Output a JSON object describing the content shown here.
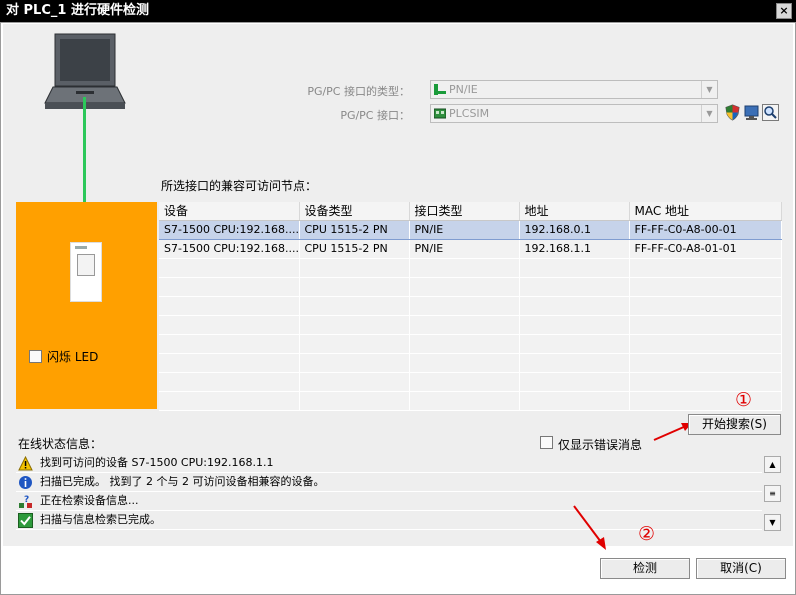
{
  "window": {
    "title": "对 PLC_1 进行硬件检测",
    "close_glyph": "×"
  },
  "interface": {
    "type_label": "PG/PC 接口的类型：",
    "type_value": "PN/IE",
    "iface_label": "PG/PC 接口：",
    "iface_value": "PLCSIM"
  },
  "nodes_label": "所选接口的兼容可访问节点：",
  "flash_led": {
    "label": "闪烁 LED",
    "checked": false
  },
  "table": {
    "columns": [
      "设备",
      "设备类型",
      "接口类型",
      "地址",
      "MAC 地址"
    ],
    "rows": [
      [
        "S7-1500 CPU:192.168....",
        "CPU 1515-2 PN",
        "PN/IE",
        "192.168.0.1",
        "FF-FF-C0-A8-00-01"
      ],
      [
        "S7-1500 CPU:192.168....",
        "CPU 1515-2 PN",
        "PN/IE",
        "192.168.1.1",
        "FF-FF-C0-A8-01-01"
      ],
      [
        "",
        "",
        "",
        "",
        ""
      ],
      [
        "",
        "",
        "",
        "",
        ""
      ],
      [
        "",
        "",
        "",
        "",
        ""
      ],
      [
        "",
        "",
        "",
        "",
        ""
      ],
      [
        "",
        "",
        "",
        "",
        ""
      ],
      [
        "",
        "",
        "",
        "",
        ""
      ],
      [
        "",
        "",
        "",
        "",
        ""
      ],
      [
        "",
        "",
        "",
        "",
        ""
      ]
    ],
    "selected_row": 0
  },
  "buttons": {
    "start_search": "开始搜索(S)",
    "detect": "检测",
    "cancel": "取消(C)"
  },
  "status": {
    "label": "在线状态信息：",
    "only_errors_label": "仅显示错误消息",
    "messages": [
      {
        "icon": "warning-icon",
        "text": "找到可访问的设备 S7-1500 CPU:192.168.1.1"
      },
      {
        "icon": "info-icon",
        "text": "扫描已完成。 找到了 2 个与 2 可访问设备相兼容的设备。"
      },
      {
        "icon": "retrieving-icon",
        "text": "正在检索设备信息..."
      },
      {
        "icon": "check-icon",
        "text": "扫描与信息检索已完成。"
      }
    ]
  },
  "annotations": {
    "first": "①",
    "second": "②"
  },
  "colors": {
    "accent_orange": "#ffa000",
    "link_green": "#2cc85a",
    "annotation_red": "#e00000",
    "selection": "#c6d3ea"
  }
}
